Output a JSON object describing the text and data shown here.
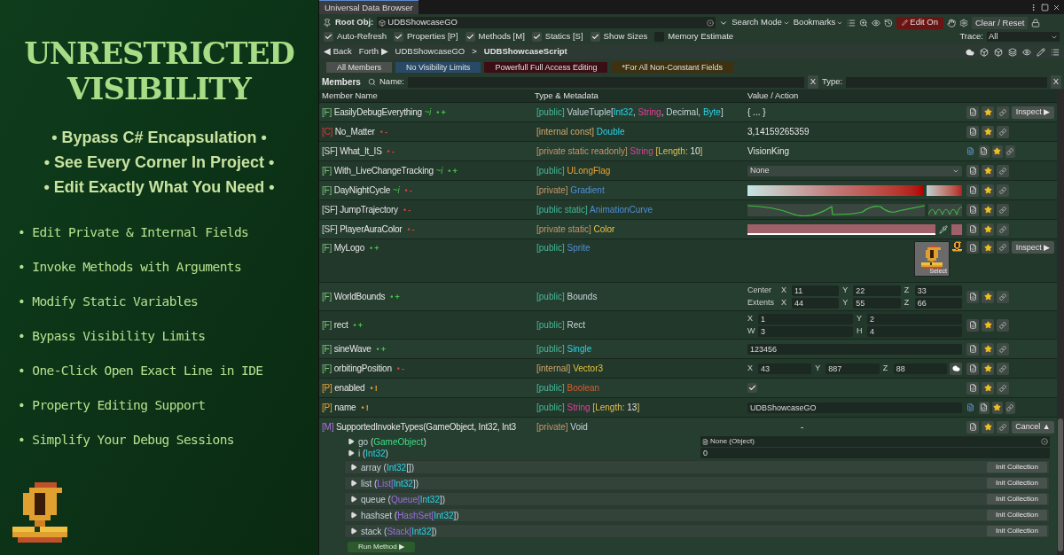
{
  "promo": {
    "title": [
      "UNRESTRICTED",
      "VISIBILITY"
    ],
    "highlights": [
      "• Bypass C# Encapsulation •",
      "• See Every Corner In Project •",
      "• Edit Exactly What You Need •"
    ],
    "features": [
      "• Edit Private & Internal Fields",
      "• Invoke Methods with Arguments",
      "• Modify Static Variables",
      "• Bypass Visibility Limits",
      "• One-Click Open Exact Line in IDE",
      "• Property Editing Support",
      "• Simplify Your Debug Sessions"
    ]
  },
  "window": {
    "title": "Universal Data Browser"
  },
  "toolbar": {
    "root_label": "Root Obj:",
    "root_value": "UDBShowcaseGO",
    "search_mode": "Search Mode",
    "bookmarks": "Bookmarks",
    "edit": {
      "label": "Edit On",
      "on": true
    },
    "clear": "Clear / Reset"
  },
  "options": [
    {
      "label": "Auto-Refresh",
      "checked": true
    },
    {
      "label": "Properties [P]",
      "checked": true
    },
    {
      "label": "Methods [M]",
      "checked": true
    },
    {
      "label": "Statics [S]",
      "checked": true
    },
    {
      "label": "Show Sizes",
      "checked": true
    },
    {
      "label": "Memory Estimate",
      "checked": false
    }
  ],
  "trace": {
    "label": "Trace:",
    "value": "All"
  },
  "nav": {
    "back": "◀ Back",
    "forth": "Forth ▶",
    "path": [
      "UDBShowcaseGO",
      "UDBShowcaseScript"
    ],
    "separator": ">"
  },
  "chips": [
    {
      "label": "All Members",
      "color": "#4b504d"
    },
    {
      "label": "No Visibility Limits",
      "color": "#294a66"
    },
    {
      "label": "Powerfull Full Access Editing",
      "color": "#3a0e14"
    },
    {
      "label": "*For All Non-Constant Fields",
      "color": "#3d3110"
    }
  ],
  "search": {
    "title": "Members",
    "name_label": "Name:",
    "name_clear": "X",
    "type_label": "Type:",
    "type_clear": "X"
  },
  "columns": [
    "Member Name",
    "Type & Metadata",
    "Value / Action"
  ],
  "members": [
    {
      "kind": "field",
      "prefix": "[F]",
      "name": "EasilyDebugEverything",
      "tag": "~i",
      "marker": {
        "text": "• +",
        "kind": "public"
      },
      "type": [
        {
          "text": "[public] ",
          "kind": "public"
        },
        {
          "text": "ValueTuple[",
          "kind": "plain"
        },
        {
          "text": "Int32",
          "kind": "primitive"
        },
        {
          "text": ", ",
          "kind": "plain"
        },
        {
          "text": "String",
          "kind": "string"
        },
        {
          "text": ", Decimal, ",
          "kind": "plain"
        },
        {
          "text": "Byte",
          "kind": "primitive"
        },
        {
          "text": "]",
          "kind": "plain"
        }
      ],
      "value": {
        "kind": "text",
        "text": "{ ... }"
      },
      "doc": false,
      "button": "Inspect ▶"
    },
    {
      "kind": "const",
      "prefix": "[C]",
      "name": "No_Matter",
      "marker": {
        "text": "• -",
        "kind": "private"
      },
      "type": [
        {
          "text": "[internal const] ",
          "kind": "internal"
        },
        {
          "text": "Double",
          "kind": "primitive"
        }
      ],
      "value": {
        "kind": "text",
        "text": "3,14159265359"
      },
      "doc": false
    },
    {
      "kind": "static",
      "prefix": "[SF]",
      "name": "What_It_IS",
      "marker": {
        "text": "• -",
        "kind": "private"
      },
      "type": [
        {
          "text": "[private static readonly] ",
          "kind": "private"
        },
        {
          "text": "String",
          "kind": "string"
        },
        {
          "text": " [Length: ",
          "kind": "meta"
        },
        {
          "text": "10",
          "kind": "number"
        },
        {
          "text": "]",
          "kind": "meta"
        }
      ],
      "value": {
        "kind": "text",
        "text": "VisionKing"
      },
      "doc": true
    },
    {
      "kind": "field",
      "prefix": "[F]",
      "name": "With_LiveChangeTracking",
      "tag": "~i",
      "marker": {
        "text": "• +",
        "kind": "public"
      },
      "type": [
        {
          "text": "[public] ",
          "kind": "public"
        },
        {
          "text": "ULongFlag",
          "kind": "enum"
        }
      ],
      "value": {
        "kind": "dropdown",
        "text": "None"
      },
      "doc": false
    },
    {
      "kind": "field",
      "prefix": "[F]",
      "name": "DayNightCycle",
      "tag": "~i",
      "marker": {
        "text": "• -",
        "kind": "private"
      },
      "type": [
        {
          "text": "[private] ",
          "kind": "private"
        },
        {
          "text": "Gradient",
          "kind": "asset"
        }
      ],
      "value": {
        "kind": "gradient"
      },
      "doc": false
    },
    {
      "kind": "static",
      "prefix": "[SF]",
      "name": "JumpTrajectory",
      "marker": {
        "text": "• -",
        "kind": "private"
      },
      "type": [
        {
          "text": "[public static] ",
          "kind": "public"
        },
        {
          "text": "AnimationCurve",
          "kind": "asset"
        }
      ],
      "value": {
        "kind": "curve"
      },
      "doc": false
    },
    {
      "kind": "static",
      "prefix": "[SF]",
      "name": "PlayerAuraColor",
      "marker": {
        "text": "• -",
        "kind": "private"
      },
      "type": [
        {
          "text": "[private static] ",
          "kind": "private"
        },
        {
          "text": "Color",
          "kind": "struct"
        }
      ],
      "value": {
        "kind": "color"
      },
      "doc": false
    },
    {
      "kind": "field",
      "prefix": "[F]",
      "name": "MyLogo",
      "marker": {
        "text": "• +",
        "kind": "public"
      },
      "type": [
        {
          "text": "[public] ",
          "kind": "public"
        },
        {
          "text": "Sprite",
          "kind": "asset"
        }
      ],
      "value": {
        "kind": "sprite",
        "text": "Select"
      },
      "doc": false,
      "button": "Inspect ▶"
    },
    {
      "kind": "field",
      "prefix": "[F]",
      "name": "WorldBounds",
      "marker": {
        "text": "• +",
        "kind": "public"
      },
      "type": [
        {
          "text": "[public] ",
          "kind": "public"
        },
        {
          "text": "Bounds",
          "kind": "plain"
        }
      ],
      "value": {
        "kind": "grid",
        "lines": [
          {
            "label": "Center",
            "fields": [
              {
                "label": "X",
                "value": "11"
              },
              {
                "label": "Y",
                "value": "22"
              },
              {
                "label": "Z",
                "value": "33"
              }
            ]
          },
          {
            "label": "Extents",
            "fields": [
              {
                "label": "X",
                "value": "44"
              },
              {
                "label": "Y",
                "value": "55"
              },
              {
                "label": "Z",
                "value": "66"
              }
            ]
          }
        ]
      },
      "doc": false
    },
    {
      "kind": "field",
      "prefix": "[F]",
      "name": "rect",
      "marker": {
        "text": "• +",
        "kind": "public"
      },
      "type": [
        {
          "text": "[public] ",
          "kind": "public"
        },
        {
          "text": "Rect",
          "kind": "plain"
        }
      ],
      "value": {
        "kind": "grid",
        "lines": [
          {
            "fields": [
              {
                "label": "X",
                "value": "1"
              },
              {
                "label": "Y",
                "value": "2"
              }
            ]
          },
          {
            "fields": [
              {
                "label": "W",
                "value": "3"
              },
              {
                "label": "H",
                "value": "4"
              }
            ]
          }
        ]
      },
      "doc": false
    },
    {
      "kind": "field",
      "prefix": "[F]",
      "name": "sineWave",
      "marker": {
        "text": "• +",
        "kind": "public"
      },
      "type": [
        {
          "text": "[public] ",
          "kind": "public"
        },
        {
          "text": "Single",
          "kind": "primitive"
        }
      ],
      "value": {
        "kind": "input",
        "text": "123456"
      },
      "doc": false
    },
    {
      "kind": "field",
      "prefix": "[F]",
      "name": "orbitingPosition",
      "marker": {
        "text": "• -",
        "kind": "private"
      },
      "type": [
        {
          "text": "[internal] ",
          "kind": "internal"
        },
        {
          "text": "Vector3",
          "kind": "struct"
        }
      ],
      "value": {
        "kind": "vector",
        "lines": [
          {
            "fields": [
              {
                "label": "X",
                "value": "43"
              },
              {
                "label": "Y",
                "value": "887"
              },
              {
                "label": "Z",
                "value": "88"
              }
            ]
          }
        ]
      },
      "doc": false
    },
    {
      "kind": "property",
      "prefix": "[P]",
      "name": "enabled",
      "marker": {
        "text": "• !",
        "kind": "property"
      },
      "type": [
        {
          "text": "[public] ",
          "kind": "public"
        },
        {
          "text": "Boolean",
          "kind": "bool"
        }
      ],
      "value": {
        "kind": "checkbox",
        "checked": true
      },
      "doc": false
    },
    {
      "kind": "property",
      "prefix": "[P]",
      "name": "name",
      "marker": {
        "text": "• !",
        "kind": "property"
      },
      "type": [
        {
          "text": "[public] ",
          "kind": "public"
        },
        {
          "text": "String",
          "kind": "string"
        },
        {
          "text": " [Length: ",
          "kind": "meta"
        },
        {
          "text": "13",
          "kind": "number"
        },
        {
          "text": "]",
          "kind": "meta"
        }
      ],
      "value": {
        "kind": "input",
        "text": "UDBShowcaseGO"
      },
      "doc": true
    },
    {
      "kind": "method",
      "prefix": "[M]",
      "name": "SupportedInvokeTypes(GameObject, Int32, Int3",
      "type": [
        {
          "text": "[private] ",
          "kind": "private"
        },
        {
          "text": "Void",
          "kind": "plain"
        }
      ],
      "value": {
        "kind": "dash",
        "text": "-"
      },
      "doc": false,
      "button": "Cancel ▲",
      "params": [
        {
          "label": [
            {
              "text": "go (",
              "kind": "plain"
            },
            {
              "text": "GameObject",
              "kind": "object"
            },
            {
              "text": ")",
              "kind": "plain"
            }
          ],
          "value": {
            "kind": "object",
            "text": "None (Object)"
          }
        },
        {
          "label": [
            {
              "text": "i (",
              "kind": "plain"
            },
            {
              "text": "Int32",
              "kind": "primitive"
            },
            {
              "text": ")",
              "kind": "plain"
            }
          ],
          "value": {
            "kind": "input",
            "text": "0"
          }
        },
        {
          "label": [
            {
              "text": "array (",
              "kind": "plain"
            },
            {
              "text": "Int32",
              "kind": "primitive"
            },
            {
              "text": "[])",
              "kind": "plain"
            }
          ],
          "value": {
            "kind": "collection",
            "text": "Init Collection"
          }
        },
        {
          "label": [
            {
              "text": "list (",
              "kind": "plain"
            },
            {
              "text": "List[",
              "kind": "collection"
            },
            {
              "text": "Int32",
              "kind": "primitive"
            },
            {
              "text": "])",
              "kind": "plain"
            }
          ],
          "value": {
            "kind": "collection",
            "text": "Init Collection"
          }
        },
        {
          "label": [
            {
              "text": "queue (",
              "kind": "plain"
            },
            {
              "text": "Queue[",
              "kind": "collection"
            },
            {
              "text": "Int32",
              "kind": "primitive"
            },
            {
              "text": "])",
              "kind": "plain"
            }
          ],
          "value": {
            "kind": "collection",
            "text": "Init Collection"
          }
        },
        {
          "label": [
            {
              "text": "hashset (",
              "kind": "plain"
            },
            {
              "text": "HashSet[",
              "kind": "collection"
            },
            {
              "text": "Int32",
              "kind": "primitive"
            },
            {
              "text": "])",
              "kind": "plain"
            }
          ],
          "value": {
            "kind": "collection",
            "text": "Init Collection"
          }
        },
        {
          "label": [
            {
              "text": "stack (",
              "kind": "plain"
            },
            {
              "text": "Stack[",
              "kind": "collection"
            },
            {
              "text": "Int32",
              "kind": "primitive"
            },
            {
              "text": "])",
              "kind": "plain"
            }
          ],
          "value": {
            "kind": "collection",
            "text": "Init Collection"
          }
        }
      ],
      "run": "Run Method ▶"
    }
  ]
}
